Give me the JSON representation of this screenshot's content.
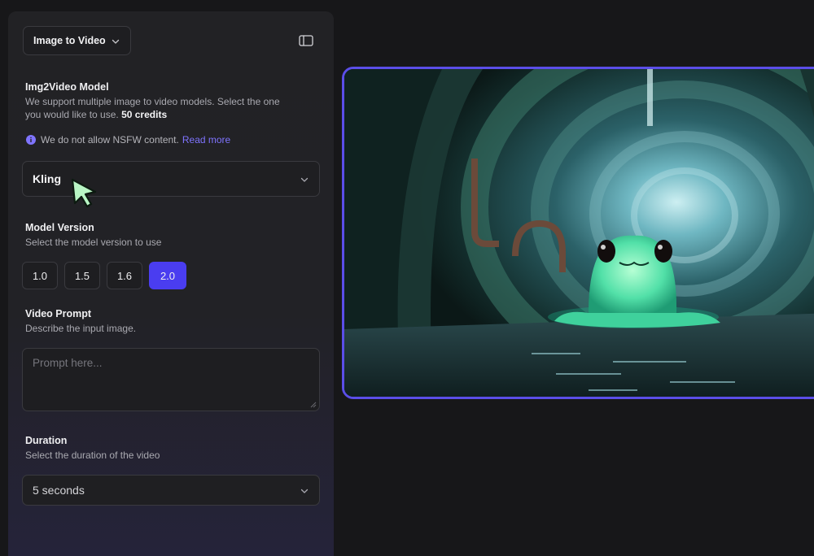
{
  "mode_select": {
    "label": "Image to Video",
    "icon": "chevron-down-icon"
  },
  "sidebar_toggle": {
    "icon": "sidebar-panel-icon"
  },
  "model_section": {
    "title": "Img2Video Model",
    "desc_line1": "We support multiple image to video models. Select the one",
    "desc_line2": "you would like to use.",
    "credits": "50 credits"
  },
  "notice": {
    "icon": "info-icon",
    "text": "We do not allow NSFW content.",
    "link": "Read more"
  },
  "model_dropdown": {
    "value": "Kling"
  },
  "version_section": {
    "title": "Model Version",
    "desc": "Select the model version to use",
    "options": [
      "1.0",
      "1.5",
      "1.6",
      "2.0"
    ],
    "selected": "2.0"
  },
  "prompt_section": {
    "title": "Video Prompt",
    "desc": "Describe the input image.",
    "placeholder": "Prompt here..."
  },
  "duration_section": {
    "title": "Duration",
    "desc": "Select the duration of the video",
    "value": "5 seconds"
  },
  "colors": {
    "accent": "#4a3df0",
    "link": "#7f74ff",
    "preview_border": "#5b4ee8",
    "cursor": "#b8f5c4"
  }
}
